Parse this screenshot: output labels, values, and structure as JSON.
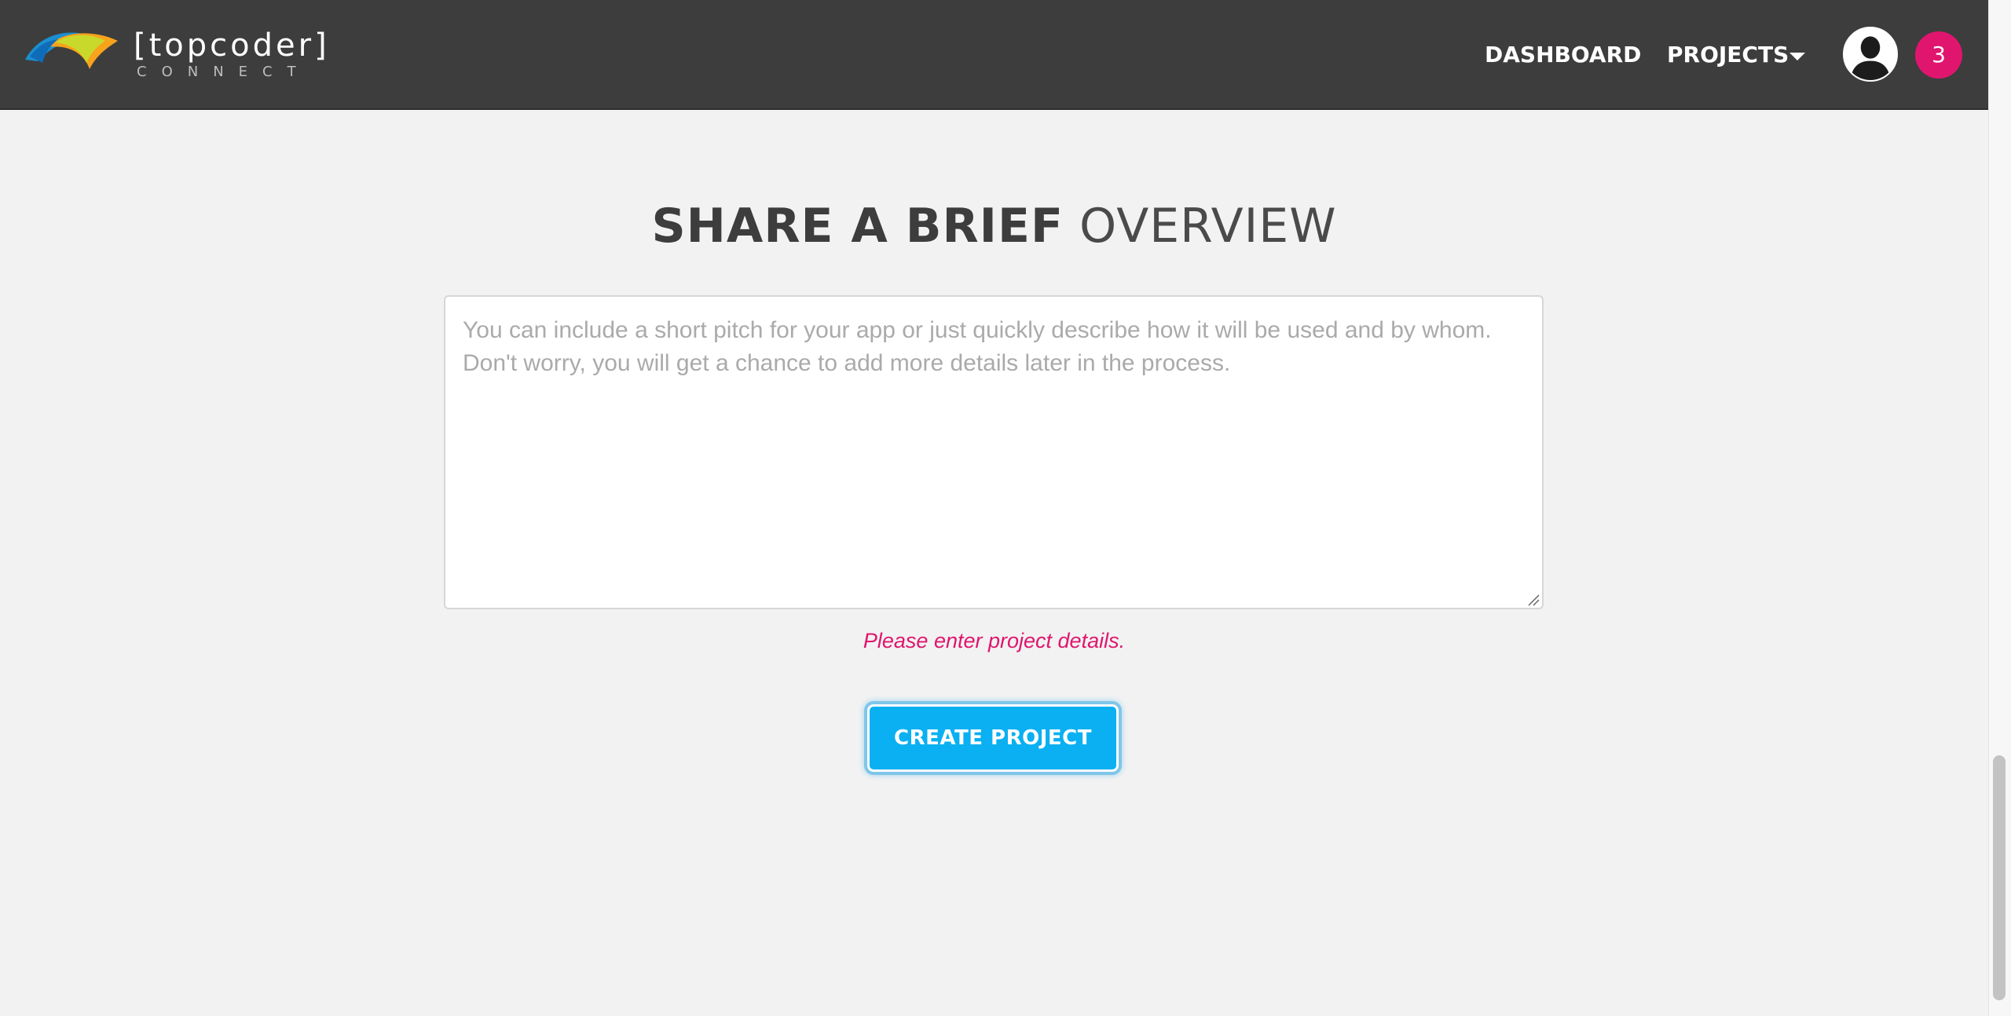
{
  "header": {
    "logo_word": "[topcoder]",
    "logo_sub": "CONNECT",
    "nav": {
      "dashboard": "DASHBOARD",
      "projects": "PROJECTS"
    },
    "notifications_count": "3",
    "icons": {
      "projects_dropdown": "caret-down-icon",
      "avatar": "user-avatar-icon"
    }
  },
  "main": {
    "heading_bold": "SHARE A BRIEF",
    "heading_light": "OVERVIEW",
    "overview": {
      "value": "",
      "placeholder": "You can include a short pitch for your app or just quickly describe how it will be used and by whom. Don't worry, you will get a chance to add more details later in the process."
    },
    "error_message": "Please enter project details.",
    "create_button_label": "CREATE PROJECT"
  },
  "colors": {
    "topbar": "#3d3d3d",
    "page_background": "#f2f2f2",
    "accent_blue": "#0ab0f2",
    "error_pink": "#e0156e",
    "badge_pink": "#e0156e"
  }
}
